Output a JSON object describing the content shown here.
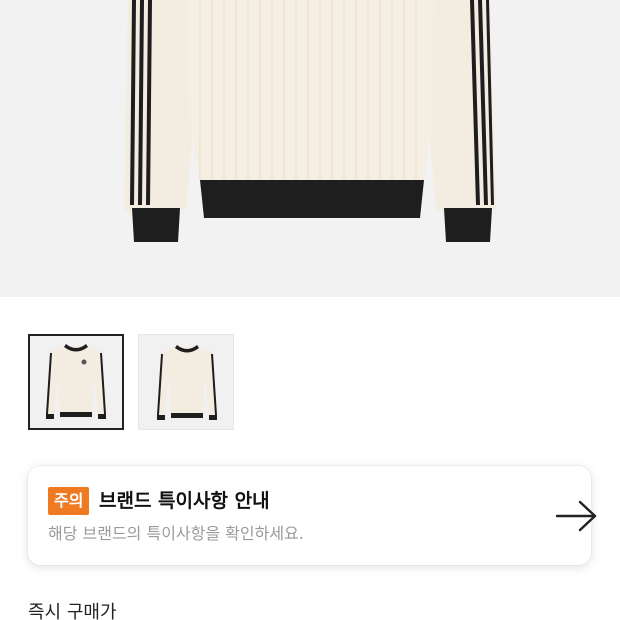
{
  "product": {
    "image_icon": "sweatshirt-image",
    "colors": {
      "body": "#f3ece0",
      "trim": "#1e1e1e",
      "background": "#f2f2f2"
    }
  },
  "thumbnails": [
    {
      "icon": "sweatshirt-thumbnail",
      "selected": true
    },
    {
      "icon": "sweatshirt-thumbnail",
      "selected": false
    }
  ],
  "notice": {
    "badge": "주의",
    "title": "브랜드 특이사항 안내",
    "description": "해당 브랜드의 특이사항을 확인하세요.",
    "arrow_icon": "arrow-right-icon",
    "badge_color": "#ef7a22"
  },
  "price_section": {
    "label": "즉시 구매가"
  }
}
